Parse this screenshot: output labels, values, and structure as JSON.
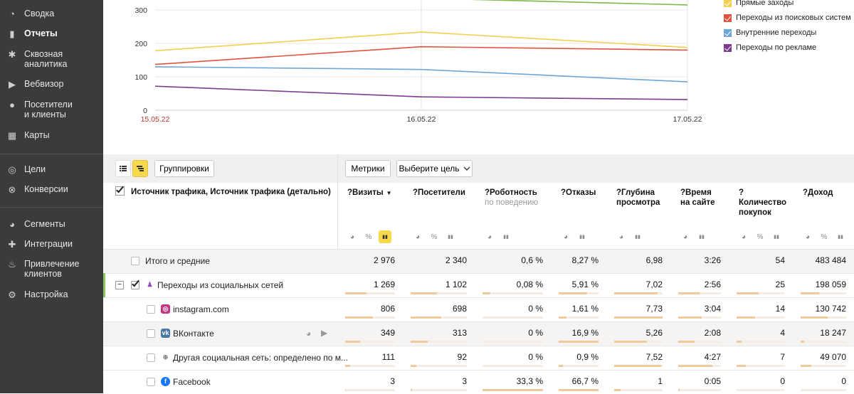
{
  "sidebar": {
    "items": [
      {
        "label": "Сводка",
        "icon": "dashboard-icon"
      },
      {
        "label": "Отчеты",
        "icon": "bar-chart-icon",
        "active": true
      },
      {
        "label": "Сквозная\nаналитика",
        "icon": "asterisk-icon"
      },
      {
        "label": "Вебвизор",
        "icon": "play-icon"
      },
      {
        "label": "Посетители\nи клиенты",
        "icon": "user-icon"
      },
      {
        "label": "Карты",
        "icon": "map-icon"
      },
      {
        "label": "Цели",
        "icon": "target-icon"
      },
      {
        "label": "Конверсии",
        "icon": "conversion-icon"
      },
      {
        "label": "Сегменты",
        "icon": "pie-icon"
      },
      {
        "label": "Интеграции",
        "icon": "puzzle-icon"
      },
      {
        "label": "Привлечение\nклиентов",
        "icon": "fire-icon"
      },
      {
        "label": "Настройка",
        "icon": "gear-icon"
      }
    ]
  },
  "chart_data": {
    "type": "line",
    "x": [
      "15.05.22",
      "16.05.22",
      "17.05.22"
    ],
    "yticks": [
      "0",
      "100",
      "200",
      "300"
    ],
    "ylim": [
      0,
      340
    ],
    "series": [
      {
        "name": "Прямые заходы",
        "color": "#f2cf4e",
        "values": [
          178,
          234,
          188
        ]
      },
      {
        "name": "Переходы из поисковых систем",
        "color": "#e0533d",
        "values": [
          137,
          190,
          180
        ]
      },
      {
        "name": "Внутренние переходы",
        "color": "#6ea8d8",
        "values": [
          130,
          122,
          85
        ]
      },
      {
        "name": "Переходы по рекламе",
        "color": "#7e3c8e",
        "values": [
          72,
          40,
          32
        ]
      },
      {
        "name": "",
        "color": "#7fb94d",
        "values": [
          null,
          null,
          315
        ]
      }
    ]
  },
  "toolbar": {
    "groupings": "Группировки",
    "metrics": "Метрики",
    "goal": "Выберите цель"
  },
  "table": {
    "dim_header": "Источник трафика, Источник трафика (детально)",
    "columns": [
      {
        "title": "Визиты",
        "sort": "▼"
      },
      {
        "title": "Посетители"
      },
      {
        "title": "Роботность",
        "sub": "по поведению"
      },
      {
        "title": "Отказы"
      },
      {
        "title": "Глубина\nпросмотра"
      },
      {
        "title": "Время\nна сайте"
      },
      {
        "title": "Количество\nпокупок"
      },
      {
        "title": "Доход"
      }
    ],
    "rows": [
      {
        "name": "Итого и средние",
        "values": [
          "2 976",
          "2 340",
          "0,6 %",
          "8,27 %",
          "6,98",
          "3:26",
          "54",
          "483 484"
        ],
        "bars": [
          0,
          0,
          0,
          0,
          0,
          0,
          0,
          0
        ]
      },
      {
        "name": "Переходы из социальных сетей",
        "values": [
          "1 269",
          "1 102",
          "0,08 %",
          "5,91 %",
          "7,02",
          "2:56",
          "25",
          "198 059"
        ],
        "bars": [
          0.43,
          0.47,
          0.13,
          0.72,
          0.9,
          0.5,
          0.46,
          0.41
        ]
      },
      {
        "name": "instagram.com",
        "values": [
          "806",
          "698",
          "0 %",
          "1,61 %",
          "7,73",
          "3:04",
          "14",
          "130 742"
        ],
        "bars": [
          0.55,
          0.55,
          0,
          0.19,
          1,
          0.55,
          0.38,
          0.6
        ]
      },
      {
        "name": "ВКонтакте",
        "values": [
          "349",
          "313",
          "0 %",
          "16,9 %",
          "5,26",
          "2:08",
          "4",
          "18 247"
        ],
        "bars": [
          0.3,
          0.3,
          0,
          1,
          0.68,
          0.38,
          0.1,
          0.08
        ]
      },
      {
        "name": "Другая социальная сеть: определено по м...",
        "values": [
          "111",
          "92",
          "0 %",
          "0,9 %",
          "7,52",
          "4:27",
          "7",
          "49 070"
        ],
        "bars": [
          0.1,
          0.1,
          0,
          0.1,
          0.97,
          0.8,
          0.19,
          0.23
        ]
      },
      {
        "name": "Facebook",
        "values": [
          "3",
          "3",
          "33,3 %",
          "66,7 %",
          "1",
          "0:05",
          "0",
          "0"
        ],
        "bars": [
          0.02,
          0.02,
          1,
          1,
          0.13,
          0.03,
          0,
          0
        ]
      }
    ]
  }
}
